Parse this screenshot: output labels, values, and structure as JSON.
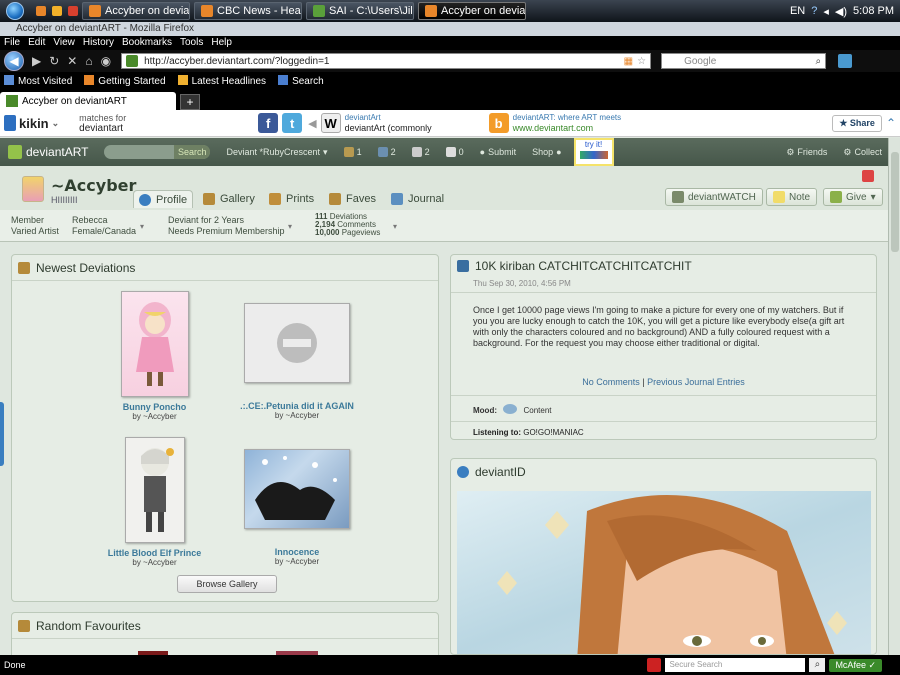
{
  "taskbar": {
    "tasks": [
      {
        "label": "Accyber on deviant..."
      },
      {
        "label": "CBC News - Health ..."
      },
      {
        "label": "SAI - C:\\Users\\Jillian..."
      },
      {
        "label": "Accyber on deviant..."
      }
    ],
    "lang": "EN",
    "clock": "5:08 PM"
  },
  "window": {
    "title": "Accyber on deviantART - Mozilla Firefox"
  },
  "menu": [
    "File",
    "Edit",
    "View",
    "History",
    "Bookmarks",
    "Tools",
    "Help"
  ],
  "nav": {
    "url": "http://accyber.deviantart.com/?loggedin=1",
    "search_placeholder": "Google"
  },
  "bookmarks": [
    "Most Visited",
    "Getting Started",
    "Latest Headlines",
    "Search"
  ],
  "tab": {
    "label": "Accyber on deviantART",
    "new_tab": "+"
  },
  "kikin": {
    "brand": "kikin",
    "matches_line1": "matches for",
    "matches_line2": "deviantart",
    "result1_line1": "deviantArt",
    "result1_line2": "deviantArt (commonly",
    "result2_line1": "deviantART: where ART meets",
    "result2_line2": "www.deviantart.com",
    "share": "Share"
  },
  "danav": {
    "logo": "deviantART",
    "search_button": "Search",
    "user": "Deviant *RubyCrescent",
    "counts": [
      "1",
      "2",
      "2",
      "0"
    ],
    "submit": "Submit",
    "shop": "Shop",
    "tryit": "try it!",
    "friends": "Friends",
    "collect": "Collect"
  },
  "profile": {
    "name": "~Accyber",
    "subtitle": "HIIIIIIII",
    "tabs": [
      "Profile",
      "Gallery",
      "Prints",
      "Faves",
      "Journal"
    ],
    "buttons": {
      "watch": "deviantWATCH",
      "note": "Note",
      "give": "Give"
    }
  },
  "stats": {
    "member_line1": "Member",
    "member_line2": "Varied Artist",
    "name_line1": "Rebecca",
    "name_line2": "Female/Canada",
    "deviant_line1": "Deviant for 2 Years",
    "deviant_line2": "Needs Premium Membership",
    "deviations": "111",
    "deviations_label": "Deviations",
    "comments": "2,194",
    "comments_label": "Comments",
    "pageviews": "10,000",
    "pageviews_label": "Pageviews"
  },
  "newest": {
    "title": "Newest Deviations",
    "items": [
      {
        "title": "Bunny Poncho",
        "by": "by ~Accyber"
      },
      {
        "title": ".:.CE:.Petunia did it AGAIN",
        "by": "by ~Accyber"
      },
      {
        "title": "Little Blood Elf Prince",
        "by": "by ~Accyber"
      },
      {
        "title": "Innocence",
        "by": "by ~Accyber"
      }
    ],
    "browse": "Browse Gallery"
  },
  "random": {
    "title": "Random Favourites"
  },
  "journal": {
    "title": "10K kiriban CATCHITCATCHITCATCHIT",
    "date": "Thu Sep 30, 2010, 4:56 PM",
    "body": "Once I get 10000 page views I'm going to make a picture for every one of my watchers. But if you you are lucky enough to catch the 10K, you will get a picture like everybody else(a gift art with only the characters coloured and no background) AND a fully coloured request with a background. For the request you may choose either traditional or digital.",
    "no_comments": "No Comments",
    "sep": "|",
    "previous": "Previous Journal Entries",
    "mood_label": "Mood:",
    "mood": "Content",
    "listening_label": "Listening to:",
    "listening": "GO!GO!MANIAC"
  },
  "deviantid": {
    "title": "deviantID"
  },
  "status": {
    "text": "Done",
    "search_placeholder": "Secure Search",
    "mcafee": "McAfee"
  }
}
